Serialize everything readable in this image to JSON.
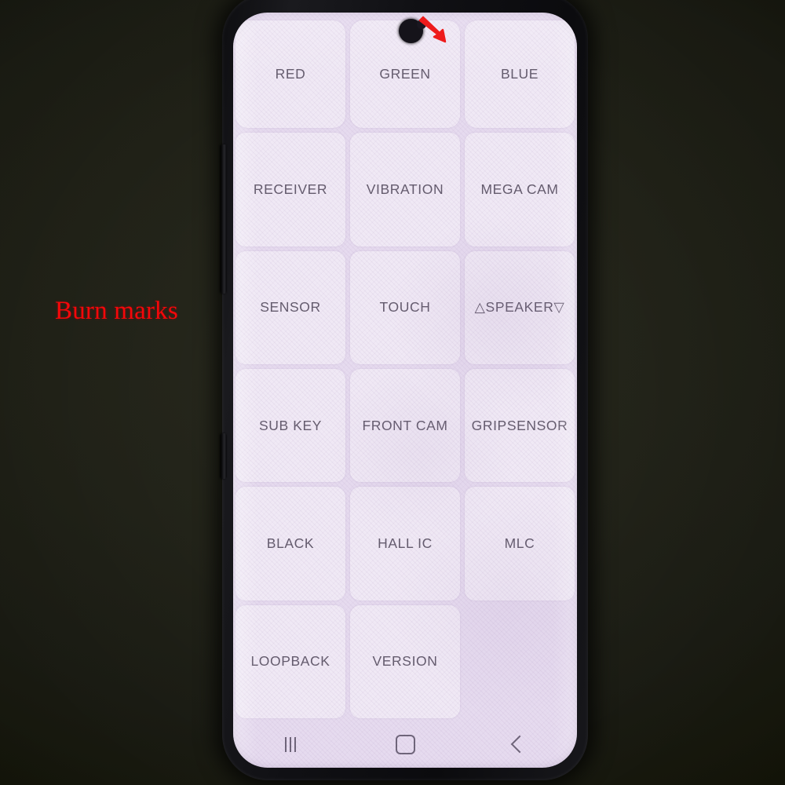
{
  "annotation": {
    "burn_marks_label": "Burn marks",
    "burn_marks_color": "#f5070a",
    "arrow_icon": "red-arrow-icon",
    "arrow_target": "punch-hole-camera"
  },
  "device": {
    "frame_color": "#101014",
    "screen_tint": "#e6dbef",
    "punch_hole_icon": "front-camera-punch-hole",
    "side_buttons": [
      "volume-rocker",
      "power-button"
    ]
  },
  "screen": {
    "app": "samsung-factory-test-menu",
    "grid": {
      "columns": 3,
      "rows": 6,
      "buttons": [
        {
          "label": "RED",
          "name": "test-button-red"
        },
        {
          "label": "GREEN",
          "name": "test-button-green"
        },
        {
          "label": "BLUE",
          "name": "test-button-blue"
        },
        {
          "label": "RECEIVER",
          "name": "test-button-receiver"
        },
        {
          "label": "VIBRATION",
          "name": "test-button-vibration"
        },
        {
          "label": "MEGA CAM",
          "name": "test-button-mega-cam"
        },
        {
          "label": "SENSOR",
          "name": "test-button-sensor"
        },
        {
          "label": "TOUCH",
          "name": "test-button-touch"
        },
        {
          "label": "△SPEAKER▽",
          "name": "test-button-speaker"
        },
        {
          "label": "SUB KEY",
          "name": "test-button-sub-key"
        },
        {
          "label": "FRONT CAM",
          "name": "test-button-front-cam"
        },
        {
          "label": "GRIPSENSOR",
          "name": "test-button-gripsensor"
        },
        {
          "label": "BLACK",
          "name": "test-button-black"
        },
        {
          "label": "HALL IC",
          "name": "test-button-hall-ic"
        },
        {
          "label": "MLC",
          "name": "test-button-mlc"
        },
        {
          "label": "LOOPBACK",
          "name": "test-button-loopback"
        },
        {
          "label": "VERSION",
          "name": "test-button-version"
        },
        {
          "label": "",
          "name": "empty-cell"
        }
      ]
    },
    "navbar": {
      "recents_icon": "recents-icon",
      "home_icon": "home-icon",
      "back_icon": "back-icon"
    }
  }
}
